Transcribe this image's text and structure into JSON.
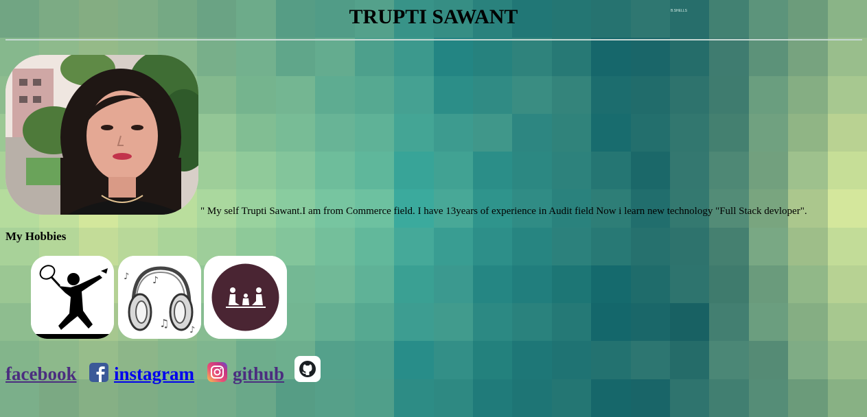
{
  "header": {
    "title": "TRUPTI SAWANT",
    "tiny_text": "B.SHELLS"
  },
  "profile": {
    "photo_icon": "profile-photo",
    "bio": "\" My self Trupti Sawant.I am from Commerce field. I have 13years of experience in Audit field Now i learn new technology \"Full Stack devloper\"."
  },
  "hobbies": {
    "title": "My Hobbies",
    "items": [
      {
        "icon": "badminton-icon"
      },
      {
        "icon": "headphones-icon"
      },
      {
        "icon": "family-icon"
      }
    ]
  },
  "social": {
    "facebook_label": "facebook",
    "instagram_label": "instagram",
    "github_label": "github",
    "colors": {
      "visited": "#4b2d7f",
      "unvisited": "#0000ee",
      "facebook_blue": "#3b5998"
    }
  },
  "colors": {
    "background_teal": "#3e9a92",
    "header_rule": "#c6d8d3"
  }
}
